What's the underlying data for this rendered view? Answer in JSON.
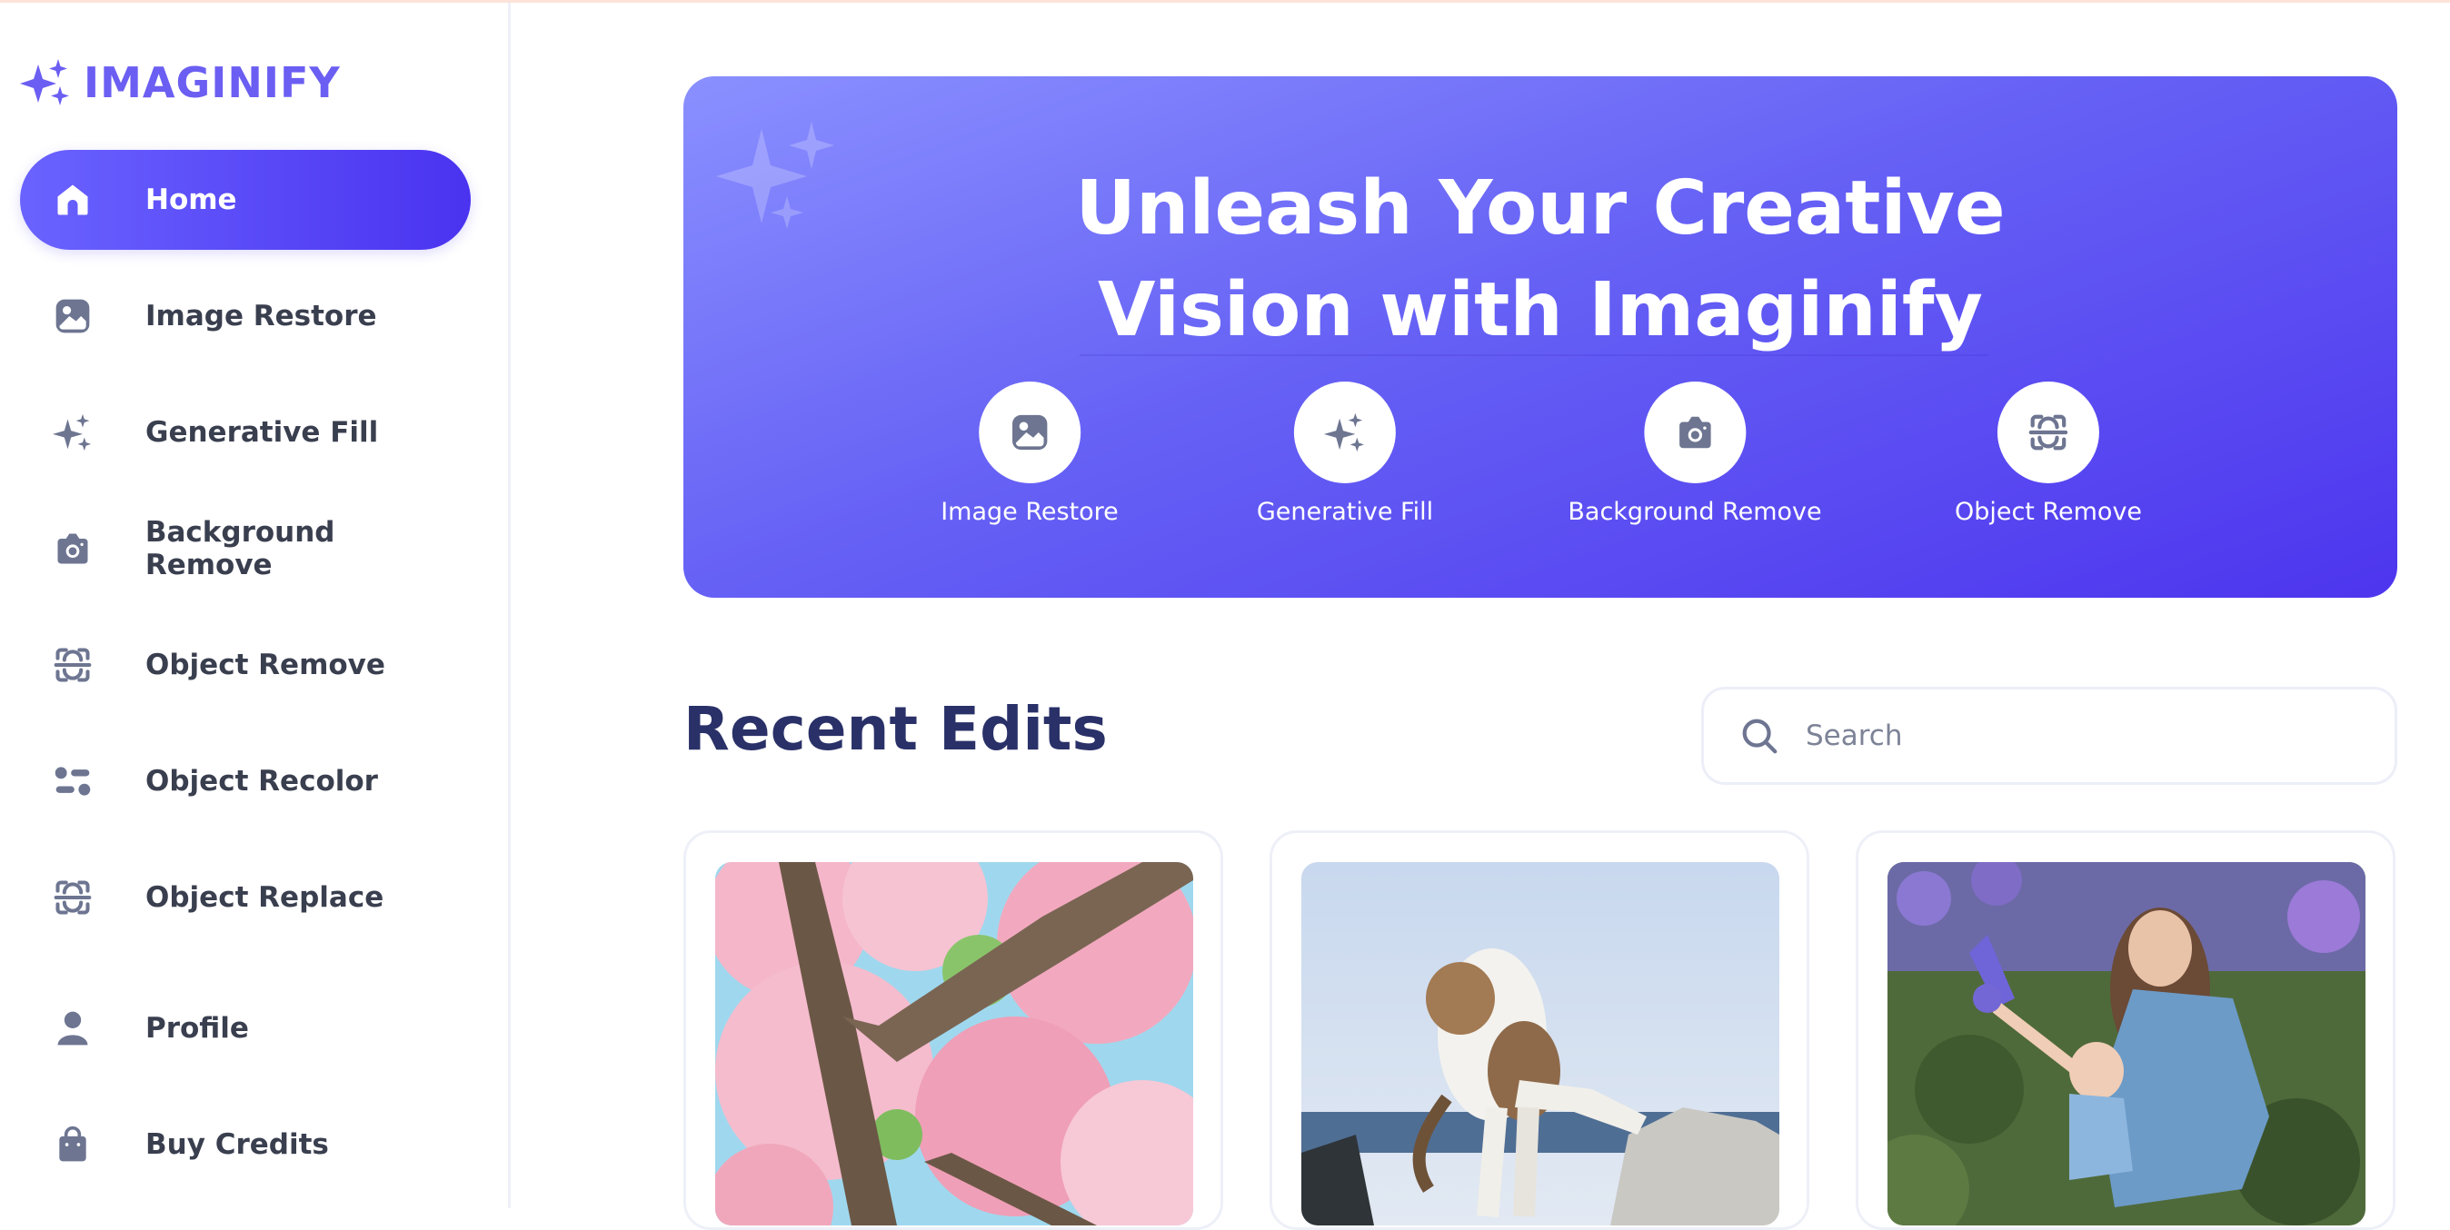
{
  "app": {
    "name": "IMAGINIFY",
    "brand_color": "#6b5ef2"
  },
  "sidebar": {
    "items": [
      {
        "label": "Home",
        "icon": "home-icon",
        "active": true
      },
      {
        "label": "Image Restore",
        "icon": "image-icon",
        "active": false
      },
      {
        "label": "Generative Fill",
        "icon": "sparkles-icon",
        "active": false
      },
      {
        "label": "Background Remove",
        "icon": "camera-icon",
        "active": false
      },
      {
        "label": "Object Remove",
        "icon": "scan-icon",
        "active": false
      },
      {
        "label": "Object Recolor",
        "icon": "filter-icon",
        "active": false
      },
      {
        "label": "Object Replace",
        "icon": "scan-icon",
        "active": false
      },
      {
        "label": "Profile",
        "icon": "user-icon",
        "active": false
      },
      {
        "label": "Buy Credits",
        "icon": "bag-icon",
        "active": false
      }
    ]
  },
  "hero": {
    "title_line1": "Unleash Your Creative",
    "title_line2": "Vision with Imaginify",
    "features": [
      {
        "label": "Image Restore",
        "icon": "image-icon"
      },
      {
        "label": "Generative Fill",
        "icon": "sparkles-icon"
      },
      {
        "label": "Background Remove",
        "icon": "camera-icon"
      },
      {
        "label": "Object Remove",
        "icon": "scan-icon"
      }
    ],
    "gradient": [
      "#8a90ff",
      "#4d35ee"
    ]
  },
  "recent": {
    "title": "Recent Edits",
    "search_placeholder": "Search",
    "images": [
      {
        "subject": "cherry blossom tree"
      },
      {
        "subject": "jumping cat"
      },
      {
        "subject": "mother and child in flowers"
      }
    ]
  }
}
